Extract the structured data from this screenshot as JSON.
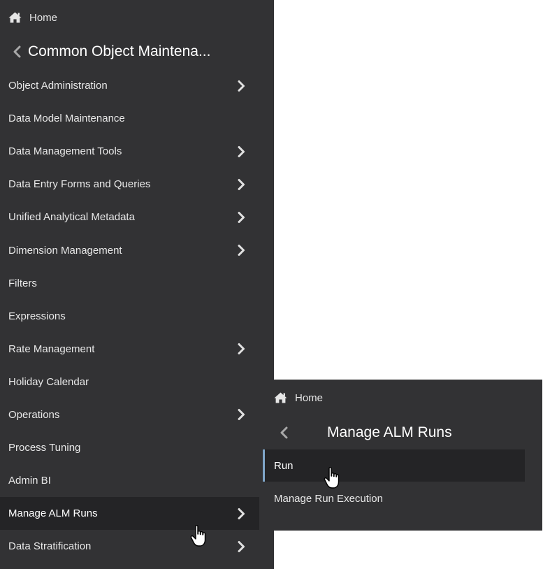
{
  "left_nav": {
    "home_label": "Home",
    "title": "Common Object Maintena...",
    "items": [
      {
        "label": "Object Administration",
        "has_submenu": true
      },
      {
        "label": "Data Model Maintenance",
        "has_submenu": false
      },
      {
        "label": "Data Management Tools",
        "has_submenu": true
      },
      {
        "label": "Data Entry Forms and Queries",
        "has_submenu": true
      },
      {
        "label": "Unified Analytical Metadata",
        "has_submenu": true
      },
      {
        "label": "Dimension Management",
        "has_submenu": true
      },
      {
        "label": "Filters",
        "has_submenu": false
      },
      {
        "label": "Expressions",
        "has_submenu": false
      },
      {
        "label": "Rate Management",
        "has_submenu": true
      },
      {
        "label": "Holiday Calendar",
        "has_submenu": false
      },
      {
        "label": "Operations",
        "has_submenu": true
      },
      {
        "label": "Process Tuning",
        "has_submenu": false
      },
      {
        "label": "Admin BI",
        "has_submenu": false
      },
      {
        "label": "Manage ALM Runs",
        "has_submenu": true,
        "active": true
      },
      {
        "label": "Data Stratification",
        "has_submenu": true
      }
    ]
  },
  "sub_nav": {
    "home_label": "Home",
    "title": "Manage ALM Runs",
    "items": [
      {
        "label": "Run",
        "selected": true
      },
      {
        "label": "Manage Run Execution",
        "selected": false
      }
    ]
  },
  "colors": {
    "panel_bg": "#323234",
    "active_bg": "#242426",
    "selected_accent": "#7fa6c9"
  },
  "icons": {
    "home": "home-icon",
    "back": "chevron-left-icon",
    "submenu": "chevron-right-icon",
    "cursor": "hand-pointer-cursor"
  }
}
